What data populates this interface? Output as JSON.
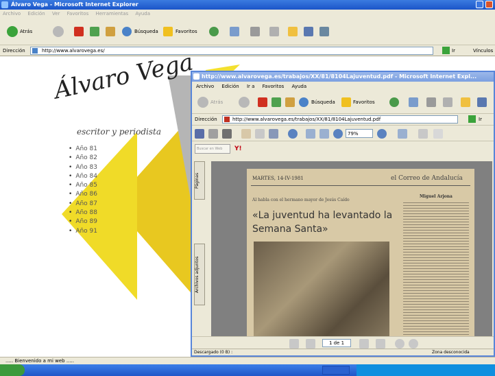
{
  "main_window": {
    "title": "Álvaro Vega - Microsoft Internet Explorer",
    "menu": [
      "Archivo",
      "Edición",
      "Ver",
      "Favoritos",
      "Herramientas",
      "Ayuda"
    ],
    "toolbar": {
      "back": "Atrás",
      "search": "Búsqueda",
      "favorites": "Favoritos"
    },
    "address_label": "Dirección",
    "address_value": "http://www.alvarovega.es/",
    "go_label": "Ir",
    "links_label": "Vínculos"
  },
  "site": {
    "logo_name": "Álvaro Vega",
    "tagline": "escritor y periodista",
    "nav": [
      "Año 81",
      "Año 82",
      "Año 83",
      "Año 84",
      "Año 85",
      "Año 86",
      "Año 87",
      "Año 88",
      "Año 89",
      "Año 91"
    ]
  },
  "status": {
    "text": "..... Bienvenido a mi web ....."
  },
  "pdf_window": {
    "title": "http://www.alvarovega.es/trabajos/XX/81/8104Lajuventud.pdf - Microsoft Internet Expl...",
    "menu": [
      "Archivo",
      "Edición",
      "Ir a",
      "Favoritos",
      "Ayuda"
    ],
    "toolbar": {
      "back": "Atrás",
      "search": "Búsqueda",
      "favorites": "Favoritos"
    },
    "address_label": "Dirección",
    "address_value": "http://www.alvarovega.es/trabajos/XX/81/8104Lajuventud.pdf",
    "go_label": "Ir",
    "zoom": "79%",
    "search_placeholder": "Buscar en Web",
    "tabs": {
      "pages": "Páginas",
      "attachments": "Archivos adjuntos"
    },
    "page_indicator": "1 de 1",
    "status_left": "Descargado (0 B) :",
    "status_right": "Zona desconocida"
  },
  "article": {
    "date": "MARTES, 14-IV-1981",
    "newspaper": "el Correo de Andalucía",
    "kicker": "Al habla con el hermano mayor de Jesús Caído",
    "headline": "«La juventud ha levantado la Semana Santa»",
    "byline": "Miguel Arjona"
  }
}
